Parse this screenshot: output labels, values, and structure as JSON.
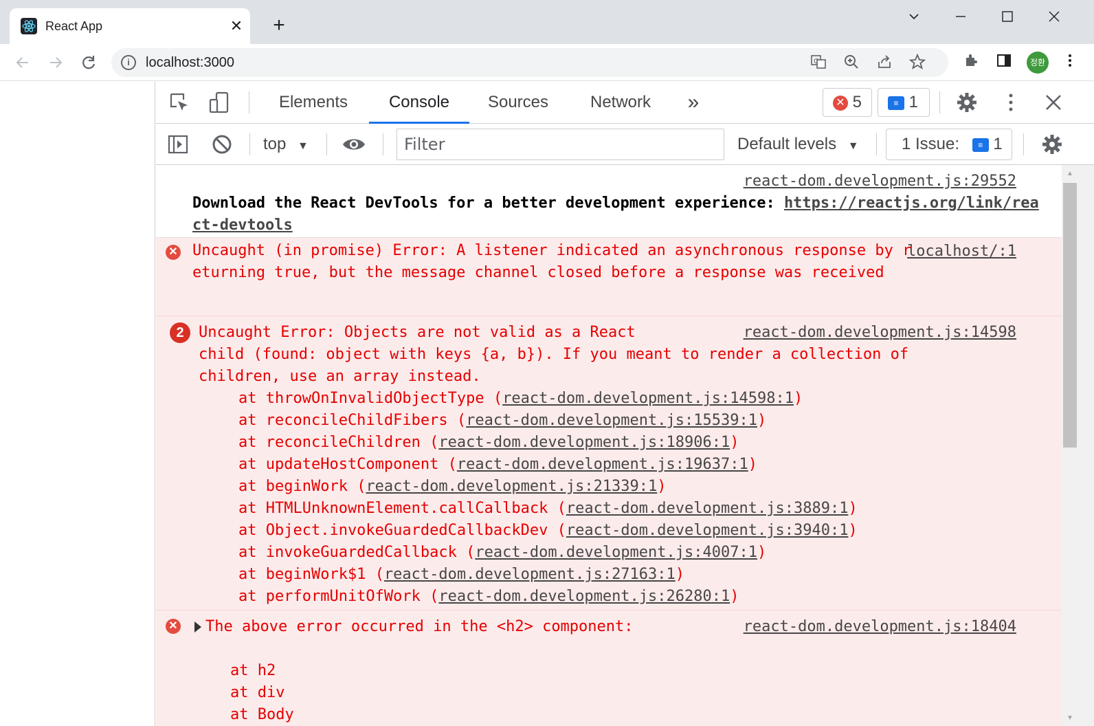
{
  "tab": {
    "title": "React App",
    "close": "✕",
    "new_tab": "+"
  },
  "window_controls": {
    "dropdown": "⌄",
    "minimize": "—",
    "maximize": "☐",
    "close": "✕"
  },
  "address_bar": {
    "url": "localhost:3000"
  },
  "profile": {
    "initials": "정환"
  },
  "devtools": {
    "tabs": [
      "Elements",
      "Console",
      "Sources",
      "Network"
    ],
    "more_tabs": "»",
    "error_count": "5",
    "message_count": "1",
    "close": "✕"
  },
  "console_bar": {
    "context": "top",
    "filter_placeholder": "Filter",
    "levels": "Default levels",
    "issues_label": "1 Issue:",
    "issues_count": "1"
  },
  "console": {
    "info": {
      "source": "react-dom.development.js:29552",
      "text": "Download the React DevTools for a better development experience: ",
      "link": "https://reactjs.org/link/react-devtools"
    },
    "error1": {
      "source": "localhost/:1",
      "text": "Uncaught (in promise) Error: A listener indicated an asynchronous response by returning true, but the message channel closed before a response was received"
    },
    "error2": {
      "count": "2",
      "source": "react-dom.development.js:14598",
      "text": "Uncaught Error: Objects are not valid as a React child (found: object with keys {a, b}). If you meant to render a collection of children, use an array instead.",
      "stack": [
        {
          "fn": "at throwOnInvalidObjectType ",
          "loc": "react-dom.development.js:14598:1"
        },
        {
          "fn": "at reconcileChildFibers ",
          "loc": "react-dom.development.js:15539:1"
        },
        {
          "fn": "at reconcileChildren ",
          "loc": "react-dom.development.js:18906:1"
        },
        {
          "fn": "at updateHostComponent ",
          "loc": "react-dom.development.js:19637:1"
        },
        {
          "fn": "at beginWork ",
          "loc": "react-dom.development.js:21339:1"
        },
        {
          "fn": "at HTMLUnknownElement.callCallback ",
          "loc": "react-dom.development.js:3889:1"
        },
        {
          "fn": "at Object.invokeGuardedCallbackDev ",
          "loc": "react-dom.development.js:3940:1"
        },
        {
          "fn": "at invokeGuardedCallback ",
          "loc": "react-dom.development.js:4007:1"
        },
        {
          "fn": "at beginWork$1 ",
          "loc": "react-dom.development.js:27163:1"
        },
        {
          "fn": "at performUnitOfWork ",
          "loc": "react-dom.development.js:26280:1"
        }
      ]
    },
    "error3": {
      "source": "react-dom.development.js:18404",
      "text": "The above error occurred in the <h2> component:",
      "stack": [
        "at h2",
        "at div",
        "at Body"
      ]
    }
  },
  "colors": {
    "error_text": "#e50000",
    "error_bg": "#fcebeb",
    "accent": "#1a73e8",
    "error_badge": "#e34b3e"
  },
  "icons": {
    "inspect": "inspect-element-icon",
    "device": "device-toolbar-icon",
    "sidebar": "console-sidebar-icon",
    "clear": "clear-console-icon",
    "eye": "live-expression-icon",
    "settings": "gear-icon",
    "kebab": "more-options-icon"
  }
}
